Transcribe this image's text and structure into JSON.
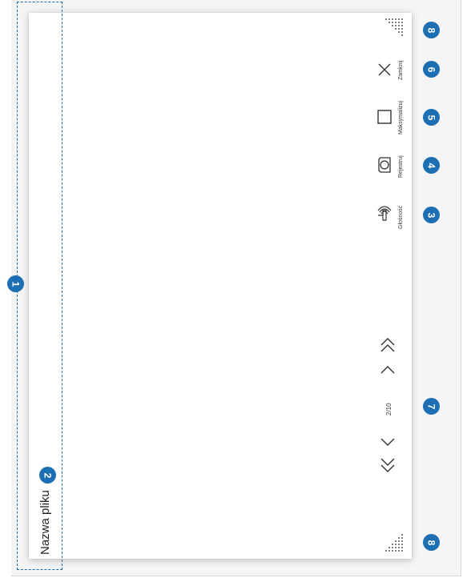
{
  "file": {
    "name": "Nazwa pliku"
  },
  "toolbar": {
    "close_label": "Zamknij",
    "maximize_label": "Maksymalizuj",
    "record_label": "Rejestruj",
    "volume_label": "Głośność"
  },
  "pagination": {
    "counter": "2/10"
  },
  "callouts": {
    "c1": "1",
    "c2": "2",
    "c3": "3",
    "c4": "4",
    "c5": "5",
    "c6": "6",
    "c7": "7",
    "c8_top": "8",
    "c8_bottom": "8"
  },
  "colors": {
    "callout": "#1d6fb4",
    "icon": "#333333"
  }
}
